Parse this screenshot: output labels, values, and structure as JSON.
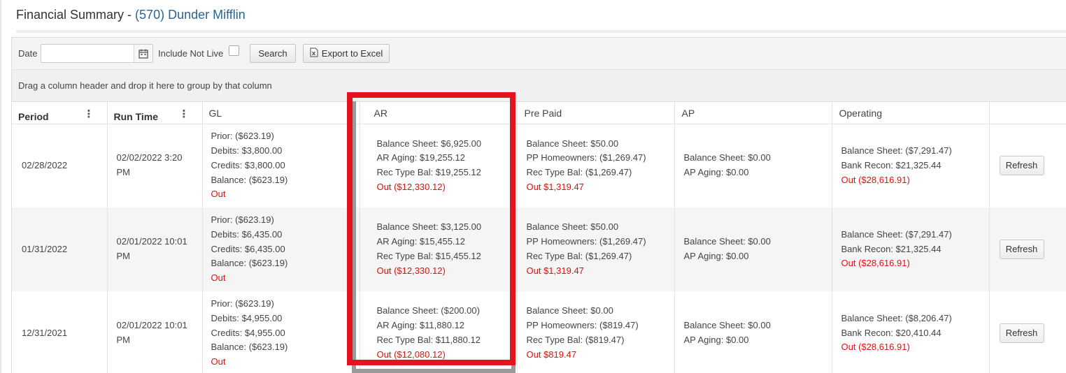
{
  "page": {
    "title_prefix": "Financial Summary - ",
    "title_org": "(570) Dunder Mifflin"
  },
  "toolbar": {
    "date_label": "Date",
    "date_value": "",
    "include_not_live_label": "Include Not Live",
    "include_not_live_checked": false,
    "search_label": "Search",
    "export_label": "Export to Excel"
  },
  "groupbar": {
    "hint": "Drag a column header and drop it here to group by that column"
  },
  "columns": {
    "period": "Period",
    "run_time": "Run Time",
    "gl": "GL",
    "ar": "AR",
    "pre_paid": "Pre Paid",
    "ap": "AP",
    "operating": "Operating"
  },
  "rows": [
    {
      "period": "02/28/2022",
      "run_time_1": "02/02/2022 3:20",
      "run_time_2": "PM",
      "gl": {
        "prior": "Prior: ($623.19)",
        "debits": "Debits: $3,800.00",
        "credits": "Credits: $3,800.00",
        "balance": "Balance: ($623.19)",
        "out": "Out"
      },
      "ar": {
        "balance_sheet": "Balance Sheet: $6,925.00",
        "aging": "AR Aging: $19,255.12",
        "rec_type": "Rec Type Bal: $19,255.12",
        "out": "Out ($12,330.12)"
      },
      "pre_paid": {
        "balance_sheet": "Balance Sheet: $50.00",
        "homeowners": "PP Homeowners: ($1,269.47)",
        "rec_type": "Rec Type Bal: ($1,269.47)",
        "out": "Out $1,319.47"
      },
      "ap": {
        "balance_sheet": "Balance Sheet: $0.00",
        "aging": "AP Aging: $0.00"
      },
      "operating": {
        "balance_sheet": "Balance Sheet: ($7,291.47)",
        "bank_recon": "Bank Recon: $21,325.44",
        "out": "Out ($28,616.91)"
      },
      "action": "Refresh"
    },
    {
      "period": "01/31/2022",
      "run_time_1": "02/01/2022 10:01",
      "run_time_2": "PM",
      "gl": {
        "prior": "Prior: ($623.19)",
        "debits": "Debits: $6,435.00",
        "credits": "Credits: $6,435.00",
        "balance": "Balance: ($623.19)",
        "out": "Out"
      },
      "ar": {
        "balance_sheet": "Balance Sheet: $3,125.00",
        "aging": "AR Aging: $15,455.12",
        "rec_type": "Rec Type Bal: $15,455.12",
        "out": "Out ($12,330.12)"
      },
      "pre_paid": {
        "balance_sheet": "Balance Sheet: $50.00",
        "homeowners": "PP Homeowners: ($1,269.47)",
        "rec_type": "Rec Type Bal: ($1,269.47)",
        "out": "Out $1,319.47"
      },
      "ap": {
        "balance_sheet": "Balance Sheet: $0.00",
        "aging": "AP Aging: $0.00"
      },
      "operating": {
        "balance_sheet": "Balance Sheet: ($7,291.47)",
        "bank_recon": "Bank Recon: $21,325.44",
        "out": "Out ($28,616.91)"
      },
      "action": "Refresh"
    },
    {
      "period": "12/31/2021",
      "run_time_1": "02/01/2022 10:01",
      "run_time_2": "PM",
      "gl": {
        "prior": "Prior: ($623.19)",
        "debits": "Debits: $4,955.00",
        "credits": "Credits: $4,955.00",
        "balance": "Balance: ($623.19)",
        "out": "Out"
      },
      "ar": {
        "balance_sheet": "Balance Sheet: ($200.00)",
        "aging": "AR Aging: $11,880.12",
        "rec_type": "Rec Type Bal: $11,880.12",
        "out": "Out ($12,080.12)"
      },
      "pre_paid": {
        "balance_sheet": "Balance Sheet: $0.00",
        "homeowners": "PP Homeowners: ($819.47)",
        "rec_type": "Rec Type Bal: ($819.47)",
        "out": "Out $819.47"
      },
      "ap": {
        "balance_sheet": "Balance Sheet: $0.00",
        "aging": "AP Aging: $0.00"
      },
      "operating": {
        "balance_sheet": "Balance Sheet: ($8,206.47)",
        "bank_recon": "Bank Recon: $20,410.44",
        "out": "Out ($28,616.91)"
      },
      "action": "Refresh"
    }
  ],
  "colors": {
    "org_link": "#2a6496",
    "out_text": "#e0100e",
    "highlight": "#e3141d"
  },
  "icons": {
    "calendar": "calendar-icon",
    "excel": "excel-icon",
    "column_menu": "kebab-menu-icon"
  }
}
